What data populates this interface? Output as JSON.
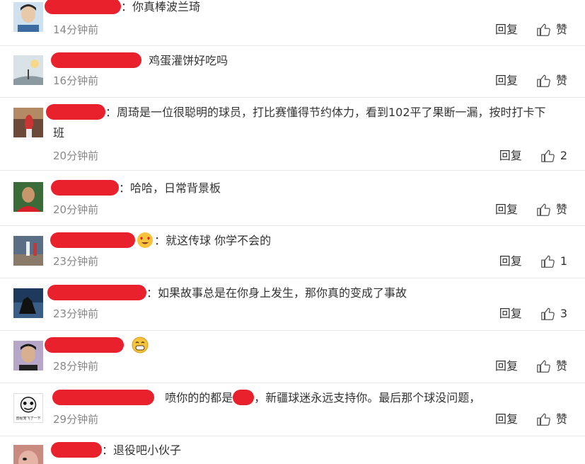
{
  "comments": [
    {
      "text": "：你真棒波兰琦",
      "time": "14分钟前",
      "reply": "回复",
      "like": "赞"
    },
    {
      "text": "鸡蛋灌饼好吃吗",
      "time": "16分钟前",
      "reply": "回复",
      "like": "赞"
    },
    {
      "text": "：周琦是一位很聪明的球员，打比赛懂得节约体力，看到102平了果断一漏，按时打卡下",
      "text2": "班",
      "time": "20分钟前",
      "reply": "回复",
      "like": "2"
    },
    {
      "text": "：哈哈，日常背景板",
      "time": "20分钟前",
      "reply": "回复",
      "like": "赞"
    },
    {
      "text": "：就这传球  你学不会的",
      "time": "23分钟前",
      "reply": "回复",
      "like": "1"
    },
    {
      "text": "：如果故事总是在你身上发生，那你真的变成了事故",
      "time": "23分钟前",
      "reply": "回复",
      "like": "3"
    },
    {
      "text": "",
      "time": "28分钟前",
      "reply": "回复",
      "like": "赞"
    },
    {
      "text": "喷你的的都是",
      "text_after": "，新疆球迷永远支持你。最后那个球没问题，",
      "time": "29分钟前",
      "reply": "回复",
      "like": "赞"
    },
    {
      "text": "：退役吧小伙子"
    }
  ],
  "avatar_caption_8": "曾经宠飞了一下",
  "colors": {
    "redaction": "#e8212d",
    "time": "#888888",
    "divider": "#e8e8e8"
  },
  "icons": {
    "like": "thumbs-up-icon",
    "emoji_smile": "grinning-emoji-icon",
    "emoji_love": "heart-eyes-emoji-icon"
  }
}
